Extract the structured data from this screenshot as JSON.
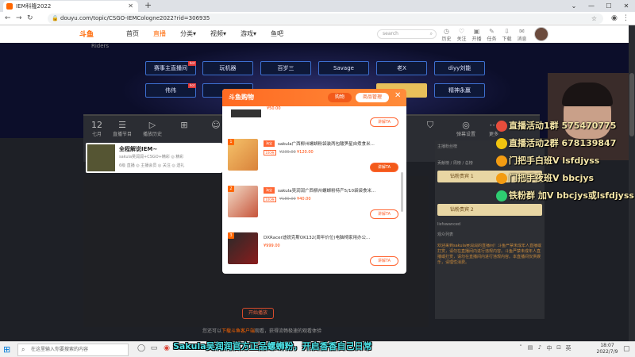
{
  "browser": {
    "tab_title": "IEM科隆2022",
    "new_tab": "+",
    "url": "douyu.com/topic/CSGO-IEMCologne2022?rid=306935",
    "controls": [
      "⌄",
      "—",
      "☐",
      "✕"
    ]
  },
  "site": {
    "logo_text": "斗鱼",
    "nav": [
      "首页",
      "直播",
      "分类▾",
      "视频▾",
      "游戏▾",
      "鱼吧"
    ],
    "search_placeholder": "search",
    "user_icons": [
      {
        "icon": "history-icon",
        "label": "历史"
      },
      {
        "icon": "follow-icon",
        "label": "关注"
      },
      {
        "icon": "live-icon",
        "label": "开播"
      },
      {
        "icon": "task-icon",
        "label": "任务"
      },
      {
        "icon": "download-icon",
        "label": "下载"
      },
      {
        "icon": "message-icon",
        "label": "消息"
      }
    ]
  },
  "banner": {
    "riders": "Riders",
    "tags_row1": [
      "赛事主直播间",
      "玩机器",
      "百岁三",
      "Savage",
      "老X",
      "diyy刘能"
    ],
    "tags_row2": [
      "伟伟",
      "",
      "",
      "",
      "",
      "精神永赢"
    ],
    "hot_label": "hot"
  },
  "toolbar": {
    "date_day": "12",
    "date_month": "七月",
    "items": [
      "直播节目",
      "播放历史",
      "",
      "",
      "",
      "",
      "",
      "",
      "",
      "",
      "",
      "弹幕设置",
      "更多"
    ]
  },
  "anchor_card": {
    "title": "全程解说IEM~",
    "line1": "sakula吴润润+CSGO+精彩 ◎ 精彩",
    "line2": "6级 直播 ◎ 主播会员 ◎ 关注 ◎ 送礼"
  },
  "right_panel": {
    "rows": [
      "主播粉丝榜",
      "贡献榜 / 周榜 / 总榜",
      "观众列表"
    ],
    "gold": [
      "钻粉贵宾 1",
      "钻粉贵宾 2"
    ],
    "user": "lisfswanced",
    "msg": "欢迎来到sakula吴润润的直播间！斗鱼严禁未成年人直播或打赏，请勿在直播间内进行违规内容。斗鱼严禁未成年人直播或打赏，请勿在直播间内进行违规内容。本直播间仅供娱乐，请理性消费。"
  },
  "modal": {
    "title": "斗鱼购物",
    "btn_cart": "购物",
    "btn_manage": "商品管理",
    "close": "✕",
    "items": [
      {
        "num": "",
        "tag": "",
        "name": "",
        "coupon": "",
        "old": "",
        "new": "¥50.00",
        "btn": "讲解TA"
      },
      {
        "num": "1",
        "tag": "淘宝",
        "name": "sakula广西柳州螺蛳粉袋装两包酸笋星自煮食米...",
        "coupon": "100券",
        "old": "¥239.00",
        "new": "¥120.00",
        "btn": "讲解TA"
      },
      {
        "num": "2",
        "tag": "淘宝",
        "name": "sakula吴润润广西柳州螺蛳粉特产5/10袋袋食米...",
        "coupon": "100券",
        "old": "¥189.00",
        "new": "¥40.00",
        "btn": "讲解TA"
      },
      {
        "num": "3",
        "tag": "",
        "name": "DXRacer迪锐克斯OK132(周年价位)电脑椅家用办公...",
        "coupon": "",
        "old": "",
        "new": "¥999.00",
        "btn": "讲解TA"
      }
    ]
  },
  "page_bottom": {
    "red_button": "开始播放",
    "note_prefix": "您还可以",
    "note_link": "下载斗鱼客户端",
    "note_suffix": "观看，获得流畅极速的观看体验"
  },
  "overlay": {
    "qq_lines": [
      {
        "icon": "qq-icon",
        "color": "#e74d3c",
        "text": "直播活动1群 575470775"
      },
      {
        "icon": "qq-icon",
        "color": "#f1c40f",
        "text": "直播活动2群 678139847"
      },
      {
        "icon": "qq-icon",
        "color": "#f39c12",
        "text": "门把手白班V  lsfdjyss"
      },
      {
        "icon": "qq-icon",
        "color": "#f39c12",
        "text": "门把手夜班V  bbcjys"
      },
      {
        "icon": "wechat-icon",
        "color": "#2ecc71",
        "text": "铁粉群  加V bbcjys或lsfdjyss"
      }
    ],
    "subtitle": "Sakula吴润润官方正品螺蛳粉，开启香香自己日常"
  },
  "taskbar": {
    "search": "在这里输入你要搜索的内容",
    "time": "18:07",
    "date": "2022/7/9"
  }
}
